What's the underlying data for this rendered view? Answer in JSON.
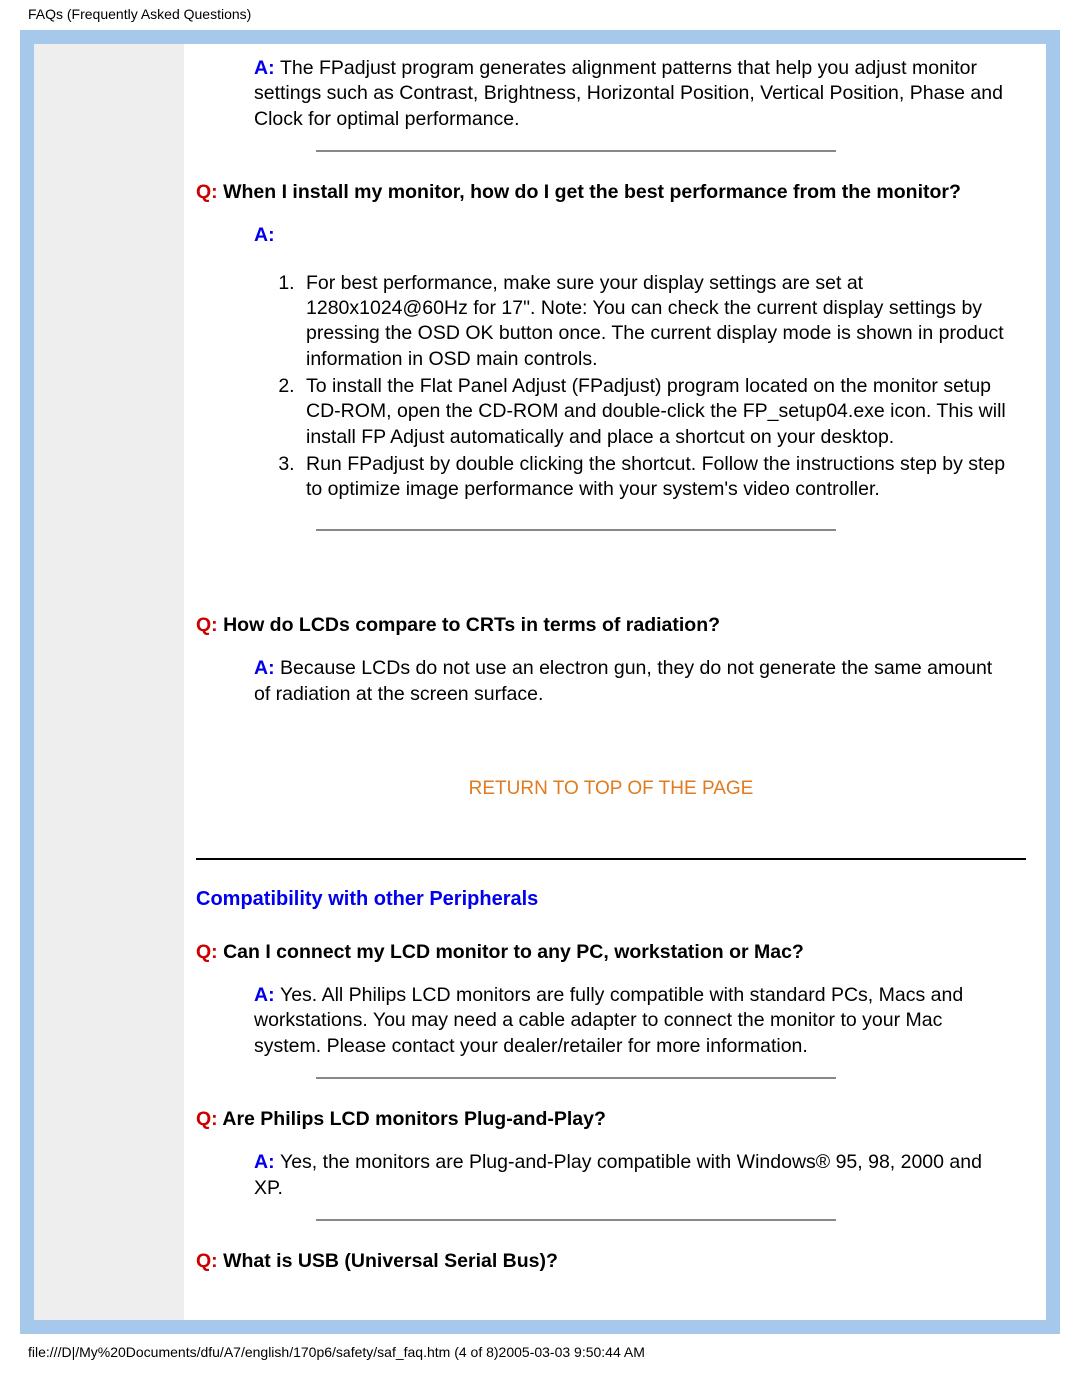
{
  "header": {
    "title": "FAQs (Frequently Asked Questions)"
  },
  "faq": {
    "a0_prefix": "A: ",
    "a0_text": "The FPadjust program generates alignment patterns that help you adjust monitor settings such as Contrast, Brightness, Horizontal Position, Vertical Position, Phase and Clock for optimal performance.",
    "q1_prefix": "Q: ",
    "q1_text": "When I install my monitor, how do I get the best performance from the monitor?",
    "a1_prefix": "A:",
    "a1_list": {
      "i1": "For best performance, make sure your display settings are set at 1280x1024@60Hz for 17\". Note: You can check the current display settings by pressing the OSD OK button once. The current display mode is shown in product information in OSD main controls.",
      "i2": "To install the Flat Panel Adjust (FPadjust) program located on the monitor setup CD-ROM, open the CD-ROM and double-click the FP_setup04.exe icon. This will install FP Adjust automatically and place a shortcut on your desktop.",
      "i3": "Run FPadjust by double clicking the shortcut. Follow the instructions step by step to optimize image performance with your system's video controller."
    },
    "q2_prefix": "Q: ",
    "q2_text": "How do LCDs compare to CRTs in terms of radiation?",
    "a2_prefix": "A: ",
    "a2_text": "Because LCDs do not use an electron gun, they do not generate the same amount of radiation at the screen surface.",
    "return_link": "RETURN TO TOP OF THE PAGE",
    "section2_title": "Compatibility with other Peripherals",
    "q3_prefix": "Q: ",
    "q3_text": "Can I connect my LCD monitor to any PC, workstation or Mac?",
    "a3_prefix": "A: ",
    "a3_text": "Yes. All Philips LCD monitors are fully compatible with standard PCs, Macs and workstations. You may need a cable adapter to connect the monitor to your Mac system. Please contact your dealer/retailer for more information.",
    "q4_prefix": "Q: ",
    "q4_text": "Are Philips LCD monitors Plug-and-Play?",
    "a4_prefix": "A: ",
    "a4_text": "Yes, the monitors are Plug-and-Play compatible with Windows® 95, 98, 2000 and XP.",
    "q5_prefix": "Q: ",
    "q5_text": "What is USB (Universal Serial Bus)?"
  },
  "footer": {
    "path": "file:///D|/My%20Documents/dfu/A7/english/170p6/safety/saf_faq.htm (4 of 8)2005-03-03 9:50:44 AM"
  }
}
